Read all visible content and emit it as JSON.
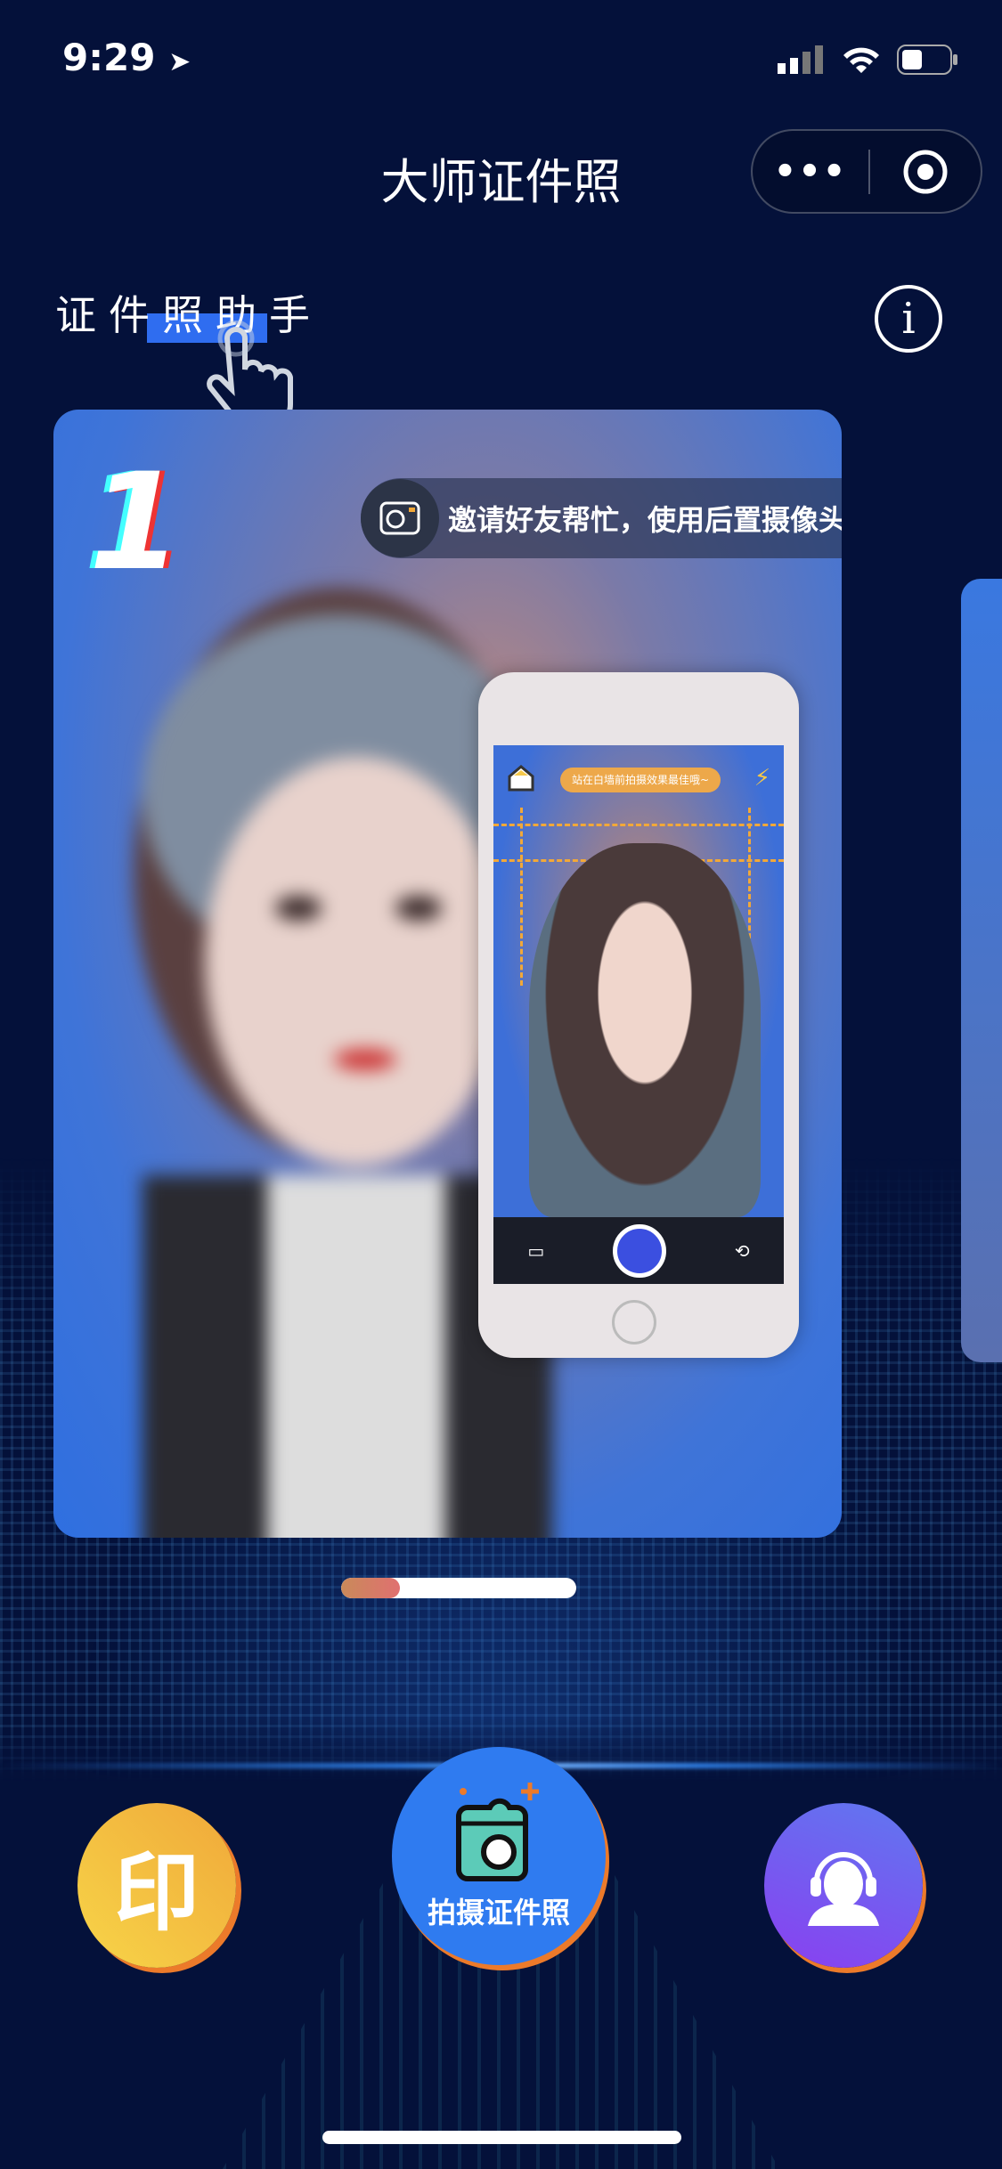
{
  "status_bar": {
    "time": "9:29"
  },
  "header": {
    "title": "大师证件照",
    "more_label": "•••"
  },
  "subtitle": "证件照助手",
  "card": {
    "step_number": "1",
    "tip": "邀请好友帮忙，使用后置摄像头",
    "phone_tip": "站在白墙前拍摄效果最佳哦~"
  },
  "carousel": {
    "progress": 0.25
  },
  "actions": {
    "print_glyph": "印",
    "shoot_label": "拍摄证件照"
  },
  "colors": {
    "background": "#04113a",
    "accent": "#2f7bf0",
    "orange": "#ec7a2a"
  }
}
